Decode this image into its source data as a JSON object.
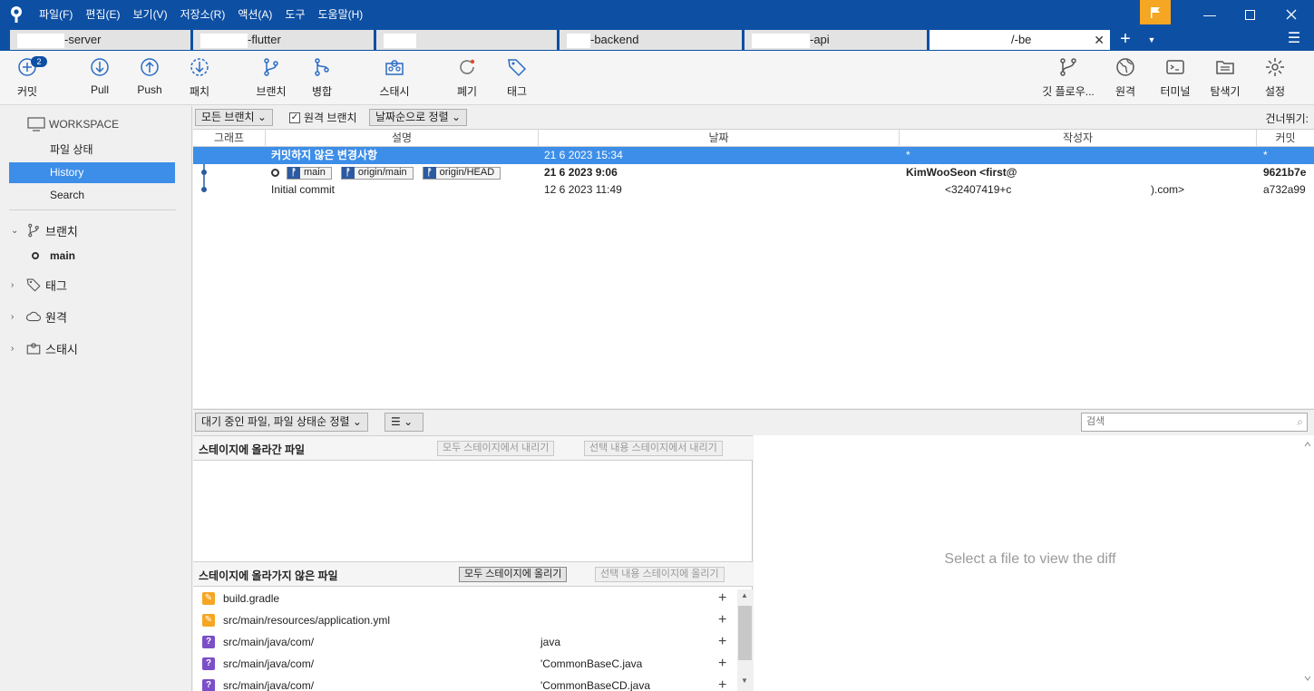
{
  "menu": [
    "파일(F)",
    "편집(E)",
    "보기(V)",
    "저장소(R)",
    "액션(A)",
    "도구",
    "도움말(H)"
  ],
  "tabs": [
    {
      "label": "-server"
    },
    {
      "label": "-flutter"
    },
    {
      "label": ""
    },
    {
      "label": "-backend"
    },
    {
      "label": "-api"
    },
    {
      "label": "/-be"
    }
  ],
  "toolbar": {
    "commit": "커밋",
    "commit_badge": "2",
    "pull": "Pull",
    "push": "Push",
    "fetch": "패치",
    "branch": "브랜치",
    "merge": "병합",
    "stash": "스태시",
    "discard": "폐기",
    "tag": "태그",
    "gitflow": "깃 플로우...",
    "remote": "원격",
    "terminal": "터미널",
    "explorer": "탐색기",
    "settings": "설정"
  },
  "sidebar": {
    "workspace": "WORKSPACE",
    "items": [
      "파일 상태",
      "History",
      "Search"
    ],
    "branches_label": "브랜치",
    "branches": [
      "main"
    ],
    "tags_label": "태그",
    "remotes_label": "원격",
    "stashes_label": "스태시"
  },
  "filters": {
    "branches": "모든 브랜치 ⌄",
    "remote_branches": "원격 브랜치",
    "sort": "날짜순으로 정렬 ⌄",
    "skip": "건너뛰기:"
  },
  "history": {
    "columns": [
      "그래프",
      "설명",
      "날짜",
      "작성자",
      "커밋"
    ],
    "rows": [
      {
        "desc": "커밋하지 않은 변경사항",
        "date": "21 6 2023 15:34",
        "author": "*",
        "commit": "*"
      },
      {
        "refs": [
          "main",
          "origin/main",
          "origin/HEAD"
        ],
        "desc": "",
        "date": "21 6 2023 9:06",
        "author": "KimWooSeon <first@",
        "commit": "9621b7e"
      },
      {
        "desc": "Initial commit",
        "date": "12 6 2023 11:49",
        "author": "<32407419+c",
        "author_tail": ").com>",
        "commit": "a732a99"
      }
    ]
  },
  "bottom": {
    "sort_dropdown": "대기 중인 파일, 파일 상태순 정렬 ⌄",
    "view_dropdown": "☰ ⌄",
    "search_placeholder": "검색",
    "staged_title": "스테이지에 올라간 파일",
    "unstage_all": "모두 스테이지에서 내리기",
    "unstage_selected": "선택 내용 스테이지에서 내리기",
    "unstaged_title": "스테이지에 올라가지 않은 파일",
    "stage_all": "모두 스테이지에 올리기",
    "stage_selected": "선택 내용 스테이지에 올리기",
    "files": [
      {
        "status": "modified",
        "path": "build.gradle",
        "tail": ""
      },
      {
        "status": "modified",
        "path": "src/main/resources/application.yml",
        "tail": ""
      },
      {
        "status": "untracked",
        "path": "src/main/java/com/",
        "tail": "java"
      },
      {
        "status": "untracked",
        "path": "src/main/java/com/",
        "tail": "'CommonBaseC.java"
      },
      {
        "status": "untracked",
        "path": "src/main/java/com/",
        "tail": "'CommonBaseCD.java"
      }
    ],
    "diff_placeholder": "Select a file to view the diff"
  }
}
